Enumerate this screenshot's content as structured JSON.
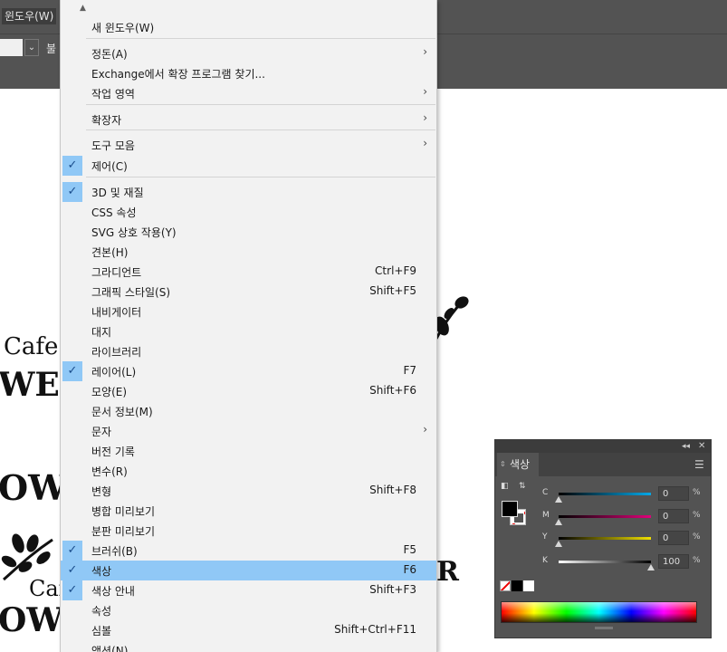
{
  "app": {
    "active_menu": "윈도우(W)",
    "control_text": "불"
  },
  "menu": {
    "items": [
      {
        "label": "새 윈도우(W)",
        "shortcut": "",
        "checked": false,
        "submenu": false,
        "highlighted": false
      },
      {
        "label": "정돈(A)",
        "shortcut": "",
        "checked": false,
        "submenu": true,
        "highlighted": false
      },
      {
        "label": "Exchange에서 확장 프로그램 찾기...",
        "shortcut": "",
        "checked": false,
        "submenu": false,
        "highlighted": false
      },
      {
        "label": "작업 영역",
        "shortcut": "",
        "checked": false,
        "submenu": true,
        "highlighted": false
      },
      {
        "label": "확장자",
        "shortcut": "",
        "checked": false,
        "submenu": true,
        "highlighted": false
      },
      {
        "label": "도구 모음",
        "shortcut": "",
        "checked": false,
        "submenu": true,
        "highlighted": false
      },
      {
        "label": "제어(C)",
        "shortcut": "",
        "checked": true,
        "submenu": false,
        "highlighted": false
      },
      {
        "label": "3D 및 재질",
        "shortcut": "",
        "checked": true,
        "submenu": false,
        "highlighted": false
      },
      {
        "label": "CSS 속성",
        "shortcut": "",
        "checked": false,
        "submenu": false,
        "highlighted": false
      },
      {
        "label": "SVG 상호 작용(Y)",
        "shortcut": "",
        "checked": false,
        "submenu": false,
        "highlighted": false
      },
      {
        "label": "견본(H)",
        "shortcut": "",
        "checked": false,
        "submenu": false,
        "highlighted": false
      },
      {
        "label": "그라디언트",
        "shortcut": "Ctrl+F9",
        "checked": false,
        "submenu": false,
        "highlighted": false
      },
      {
        "label": "그래픽 스타일(S)",
        "shortcut": "Shift+F5",
        "checked": false,
        "submenu": false,
        "highlighted": false
      },
      {
        "label": "내비게이터",
        "shortcut": "",
        "checked": false,
        "submenu": false,
        "highlighted": false
      },
      {
        "label": "대지",
        "shortcut": "",
        "checked": false,
        "submenu": false,
        "highlighted": false
      },
      {
        "label": "라이브러리",
        "shortcut": "",
        "checked": false,
        "submenu": false,
        "highlighted": false
      },
      {
        "label": "레이어(L)",
        "shortcut": "F7",
        "checked": true,
        "submenu": false,
        "highlighted": false
      },
      {
        "label": "모양(E)",
        "shortcut": "Shift+F6",
        "checked": false,
        "submenu": false,
        "highlighted": false
      },
      {
        "label": "문서 정보(M)",
        "shortcut": "",
        "checked": false,
        "submenu": false,
        "highlighted": false
      },
      {
        "label": "문자",
        "shortcut": "",
        "checked": false,
        "submenu": true,
        "highlighted": false
      },
      {
        "label": "버전 기록",
        "shortcut": "",
        "checked": false,
        "submenu": false,
        "highlighted": false
      },
      {
        "label": "변수(R)",
        "shortcut": "",
        "checked": false,
        "submenu": false,
        "highlighted": false
      },
      {
        "label": "변형",
        "shortcut": "Shift+F8",
        "checked": false,
        "submenu": false,
        "highlighted": false
      },
      {
        "label": "병합 미리보기",
        "shortcut": "",
        "checked": false,
        "submenu": false,
        "highlighted": false
      },
      {
        "label": "분판 미리보기",
        "shortcut": "",
        "checked": false,
        "submenu": false,
        "highlighted": false
      },
      {
        "label": "브러쉬(B)",
        "shortcut": "F5",
        "checked": true,
        "submenu": false,
        "highlighted": false
      },
      {
        "label": "색상",
        "shortcut": "F6",
        "checked": true,
        "submenu": false,
        "highlighted": true
      },
      {
        "label": "색상 안내",
        "shortcut": "Shift+F3",
        "checked": true,
        "submenu": false,
        "highlighted": false
      },
      {
        "label": "속성",
        "shortcut": "",
        "checked": false,
        "submenu": false,
        "highlighted": false
      },
      {
        "label": "심볼",
        "shortcut": "Shift+Ctrl+F11",
        "checked": false,
        "submenu": false,
        "highlighted": false
      },
      {
        "label": "액션(N)",
        "shortcut": "",
        "checked": false,
        "submenu": false,
        "highlighted": false
      }
    ]
  },
  "canvas_text": {
    "cafe_top": "Cafe",
    "wer": "WER",
    "ow": "OW",
    "r": "R",
    "cafe_bottom": "Caf",
    "owf": "OWF"
  },
  "color_panel": {
    "tab_label": "색상",
    "channels": [
      {
        "name": "C",
        "value": "0",
        "unit": "%",
        "color": "#00a8e8"
      },
      {
        "name": "M",
        "value": "0",
        "unit": "%",
        "color": "#e0007a"
      },
      {
        "name": "Y",
        "value": "0",
        "unit": "%",
        "color": "#f0e000"
      },
      {
        "name": "K",
        "value": "100",
        "unit": "%",
        "color": "#000000"
      }
    ]
  }
}
